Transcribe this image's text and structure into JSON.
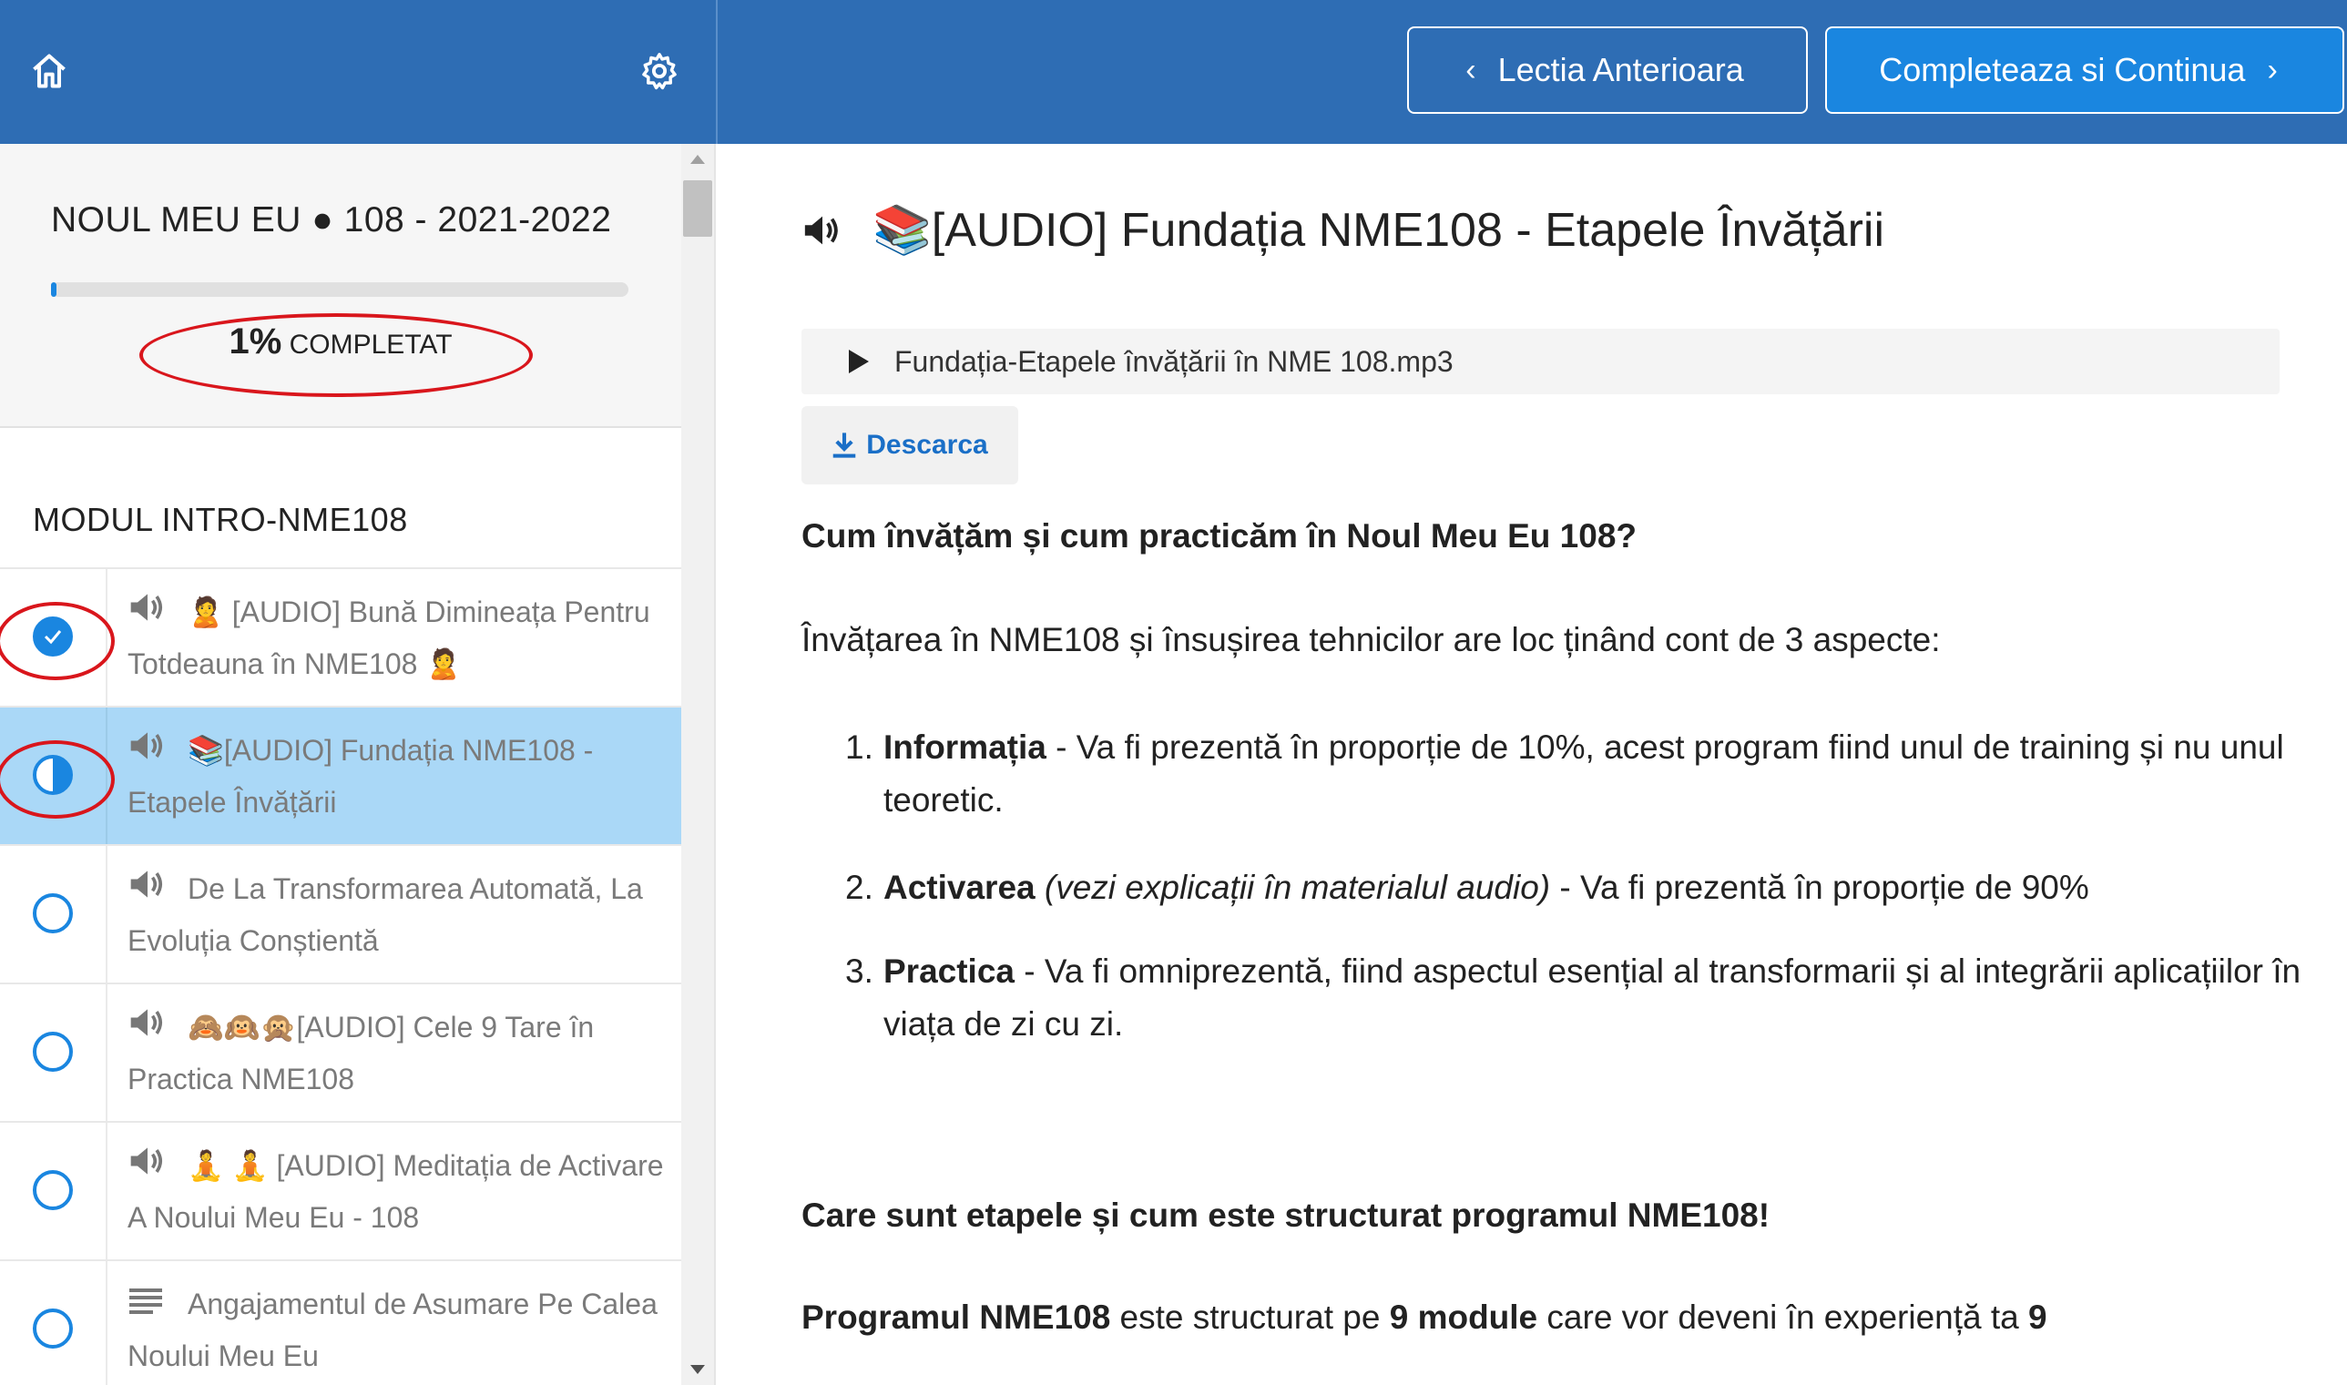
{
  "colors": {
    "header": "#2e6db4",
    "accent": "#1a86e0",
    "active_row": "#aad8f7",
    "annotation": "#d9161c"
  },
  "topbar": {
    "home_icon": "home-icon",
    "settings_icon": "gear-icon",
    "prev_label": "Lectia Anterioara",
    "next_label": "Completeaza si Continua"
  },
  "course": {
    "title": "NOUL MEU EU ● 108 - 2021-2022",
    "progress_percent": 1,
    "progress_value": "1%",
    "progress_suffix": "COMPLETAT"
  },
  "module": {
    "title": "MODUL INTRO-NME108",
    "lessons": [
      {
        "icon": "speaker-icon",
        "label": "🙎 [AUDIO] Bună Dimineața Pentru Totdeauna în NME108 🙎",
        "status": "completed"
      },
      {
        "icon": "speaker-icon",
        "label": "📚[AUDIO] Fundația NME108 - Etapele Învățării",
        "status": "in-progress"
      },
      {
        "icon": "speaker-icon",
        "label": "De La Transformarea Automată, La Evoluția Conștientă",
        "status": "not-started"
      },
      {
        "icon": "speaker-icon",
        "label": "🙈🙉🙊[AUDIO] Cele 9 Tare în Practica NME108",
        "status": "not-started"
      },
      {
        "icon": "speaker-icon",
        "label": "🧘 🧘 [AUDIO] Meditația de Activare A Noului Meu Eu - 108",
        "status": "not-started"
      },
      {
        "icon": "text-lines-icon",
        "label": "Angajamentul de Asumare Pe Calea Noului Meu Eu",
        "status": "not-started"
      }
    ]
  },
  "main": {
    "title": "📚[AUDIO] Fundația NME108 - Etapele Învățării",
    "audio_file": "Fundația-Etapele învățării în NME 108.mp3",
    "download_label": "Descarca",
    "question1": "Cum învățăm și cum practicăm în Noul Meu Eu 108?",
    "intro": "Învățarea în NME108 și însușirea tehnicilor are loc ținând cont de 3 aspecte:",
    "items": [
      {
        "num": "1.",
        "bold": "Informația",
        "italic": "",
        "rest": " - Va fi prezentă în proporție de 10%, acest program fiind unul de training și nu unul teoretic."
      },
      {
        "num": "2.",
        "bold": "Activarea",
        "italic": " (vezi explicații în materialul audio)",
        "rest": " - Va fi prezentă în proporție de 90%"
      },
      {
        "num": "3.",
        "bold": "Practica",
        "italic": "",
        "rest": " - Va fi omniprezentă, fiind aspectul esențial al transformarii și al integrării aplicațiilor în viața de zi cu zi."
      }
    ],
    "question2": "Care sunt etapele și cum este structurat programul NME108!",
    "program": {
      "b1": "Programul NME108",
      "t1": " este structurat pe ",
      "b2": "9 module",
      "t2": " care vor deveni în experiență ta ",
      "b3": "9"
    }
  }
}
